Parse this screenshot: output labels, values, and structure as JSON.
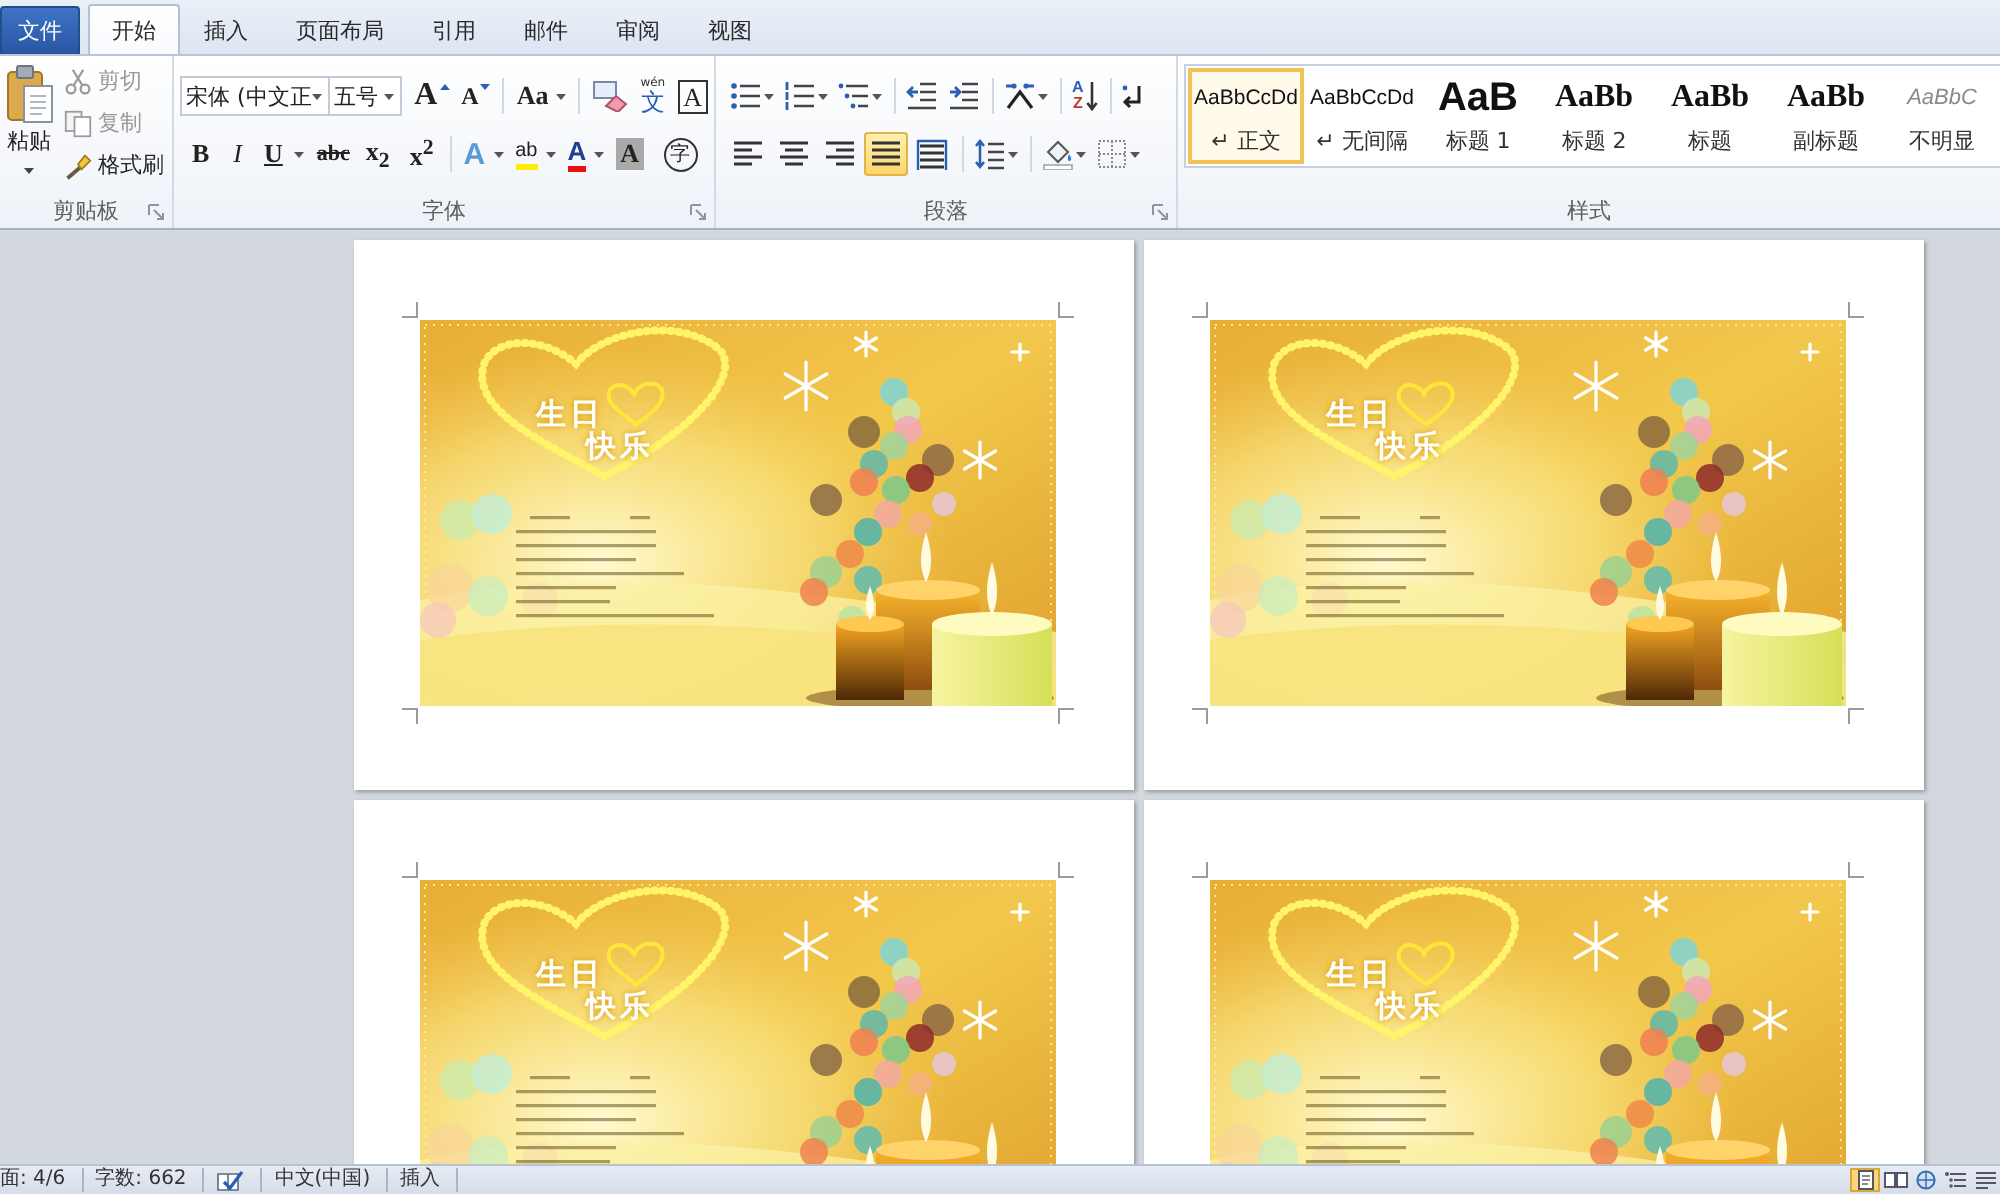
{
  "tabs": [
    {
      "label": "文件",
      "kind": "file",
      "selected": false
    },
    {
      "label": "开始",
      "kind": "tab",
      "selected": true
    },
    {
      "label": "插入",
      "kind": "tab",
      "selected": false
    },
    {
      "label": "页面布局",
      "kind": "tab",
      "selected": false
    },
    {
      "label": "引用",
      "kind": "tab",
      "selected": false
    },
    {
      "label": "邮件",
      "kind": "tab",
      "selected": false
    },
    {
      "label": "审阅",
      "kind": "tab",
      "selected": false
    },
    {
      "label": "视图",
      "kind": "tab",
      "selected": false
    }
  ],
  "clipboard": {
    "paste": "粘贴",
    "actions": [
      {
        "label": "剪切",
        "kind": "cut",
        "disabled": true
      },
      {
        "label": "复制",
        "kind": "copy",
        "disabled": true
      },
      {
        "label": "格式刷",
        "kind": "painter",
        "disabled": false
      }
    ],
    "group_label": "剪贴板"
  },
  "font": {
    "font_name": "宋体 (中文正",
    "font_size": "五号",
    "row1": [
      {
        "kind": "grow",
        "label": "A"
      },
      {
        "kind": "shrink",
        "label": "A"
      },
      {
        "kind": "case",
        "label": "Aa"
      },
      {
        "kind": "clear"
      },
      {
        "kind": "phonetic",
        "label": "文",
        "ruby": "wén"
      },
      {
        "kind": "border",
        "label": "A"
      }
    ],
    "row2": [
      {
        "kind": "bold",
        "label": "B"
      },
      {
        "kind": "italic",
        "label": "I"
      },
      {
        "kind": "underline",
        "label": "U"
      },
      {
        "kind": "strike",
        "label": "abc"
      },
      {
        "kind": "sub",
        "label": "x$_{2}$"
      },
      {
        "kind": "sup",
        "label": "x$^{2}$"
      },
      {
        "kind": "effects",
        "label": "A"
      },
      {
        "kind": "highlight",
        "label": "ab"
      },
      {
        "kind": "color",
        "label": "A"
      },
      {
        "kind": "shading",
        "label": "A"
      },
      {
        "kind": "enclose",
        "label": "字"
      }
    ],
    "group_label": "字体"
  },
  "paragraph": {
    "sort_letters": [
      "A",
      "Z"
    ],
    "alignment": [
      {
        "kind": "left",
        "selected": false
      },
      {
        "kind": "center",
        "selected": false
      },
      {
        "kind": "right",
        "selected": false
      },
      {
        "kind": "justify",
        "selected": true
      },
      {
        "kind": "distribute",
        "selected": false
      }
    ],
    "group_label": "段落"
  },
  "styles": {
    "items": [
      {
        "kind": "normal",
        "preview": "AaBbCcDd",
        "label": "↵ 正文",
        "selected": true
      },
      {
        "kind": "no-spacing",
        "preview": "AaBbCcDd",
        "label": "↵ 无间隔",
        "selected": false
      },
      {
        "kind": "heading1",
        "preview": "AaB",
        "label": "标题 1",
        "selected": false
      },
      {
        "kind": "heading2",
        "preview": "AaBb",
        "label": "标题 2",
        "selected": false
      },
      {
        "kind": "title",
        "preview": "AaBb",
        "label": "标题",
        "selected": false
      },
      {
        "kind": "subtitle",
        "preview": "AaBb",
        "label": "副标题",
        "selected": false
      },
      {
        "kind": "subtle",
        "preview": "AaBbC",
        "label": "不明显",
        "selected": false
      }
    ],
    "group_label": "样式"
  },
  "pages": [
    {
      "greeting": [
        "生日",
        "快乐"
      ]
    },
    {
      "greeting": [
        "生日",
        "快乐"
      ]
    },
    {
      "greeting": [
        "生日",
        "快乐"
      ]
    },
    {
      "greeting": [
        "生日",
        "快乐"
      ]
    }
  ],
  "status_bar": {
    "items": [
      {
        "kind": "page",
        "text": "面: 4/6"
      },
      {
        "kind": "words",
        "text": "字数: 662"
      },
      {
        "kind": "proofing"
      },
      {
        "kind": "language",
        "text": "中文(中国)"
      },
      {
        "kind": "mode",
        "text": "插入"
      }
    ],
    "views": [
      {
        "kind": "print",
        "selected": true
      },
      {
        "kind": "reading",
        "selected": false
      },
      {
        "kind": "web",
        "selected": false
      },
      {
        "kind": "outline",
        "selected": false
      },
      {
        "kind": "draft",
        "selected": false
      }
    ]
  }
}
